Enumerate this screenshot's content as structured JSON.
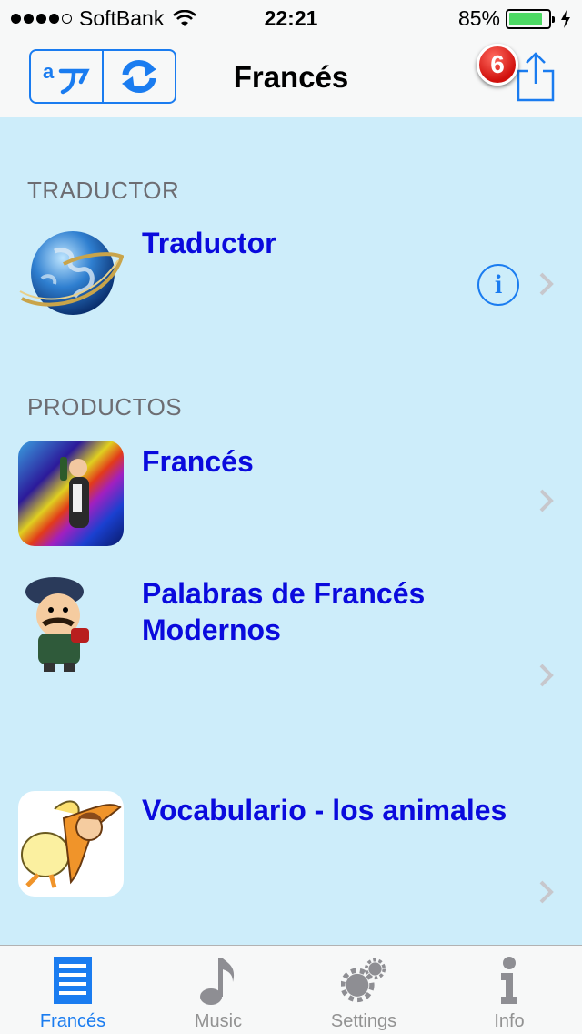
{
  "status_bar": {
    "carrier": "SoftBank",
    "time": "22:21",
    "battery_percent": "85%",
    "battery_level": 0.85,
    "signal_strength": 4
  },
  "nav_bar": {
    "title": "Francés",
    "badge_count": "6",
    "left_segment_icons": [
      "translate-icon",
      "sync-icon"
    ],
    "right_icon": "share-icon"
  },
  "sections": [
    {
      "header": "TRADUCTOR",
      "items": [
        {
          "title": "Traductor",
          "icon": "globe-icon",
          "info_icon": "i"
        }
      ]
    },
    {
      "header": "PRODUCTOS",
      "items": [
        {
          "title": "Francés",
          "icon": "app-thumbnail-frances"
        },
        {
          "title": "Palabras de Francés Modernos",
          "title_line1": "Palabras de Francés",
          "title_line2": "Modernos",
          "icon": "app-thumbnail-palabras"
        },
        {
          "title": "Vocabulario - los animales",
          "icon": "app-thumbnail-vocabulario"
        }
      ]
    }
  ],
  "tab_bar": {
    "tabs": [
      {
        "label": "Francés",
        "icon": "list-icon",
        "active": true
      },
      {
        "label": "Music",
        "icon": "music-note-icon",
        "active": false
      },
      {
        "label": "Settings",
        "icon": "gears-icon",
        "active": false
      },
      {
        "label": "Info",
        "icon": "info-icon",
        "active": false
      }
    ]
  },
  "colors": {
    "accent": "#1a7cf0",
    "link_text": "#0a0add",
    "background": "#cdedfa",
    "badge": "#d0100c"
  }
}
